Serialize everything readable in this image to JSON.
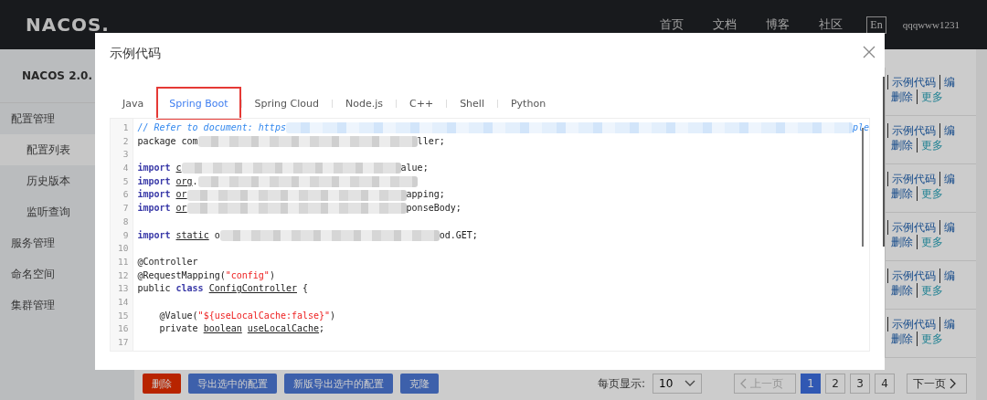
{
  "header": {
    "logo": "NACOS.",
    "nav": [
      "首页",
      "文档",
      "博客",
      "社区"
    ],
    "language": "En",
    "user": "qqqwww1231"
  },
  "sidebar": {
    "title": "NACOS 2.0.",
    "items": [
      {
        "label": "配置管理",
        "selected": false,
        "children": [
          {
            "label": "配置列表",
            "selected": true
          },
          {
            "label": "历史版本",
            "selected": false
          },
          {
            "label": "监听查询",
            "selected": false
          }
        ]
      },
      {
        "label": "服务管理",
        "selected": false
      },
      {
        "label": "命名空间",
        "selected": false
      },
      {
        "label": "集群管理",
        "selected": false
      }
    ]
  },
  "row_actions": [
    {
      "sample": "示例代码",
      "edit": "编",
      "delete": "删除",
      "more": "更多"
    },
    {
      "sample": "示例代码",
      "edit": "编",
      "delete": "删除",
      "more": "更多"
    },
    {
      "sample": "示例代码",
      "edit": "编",
      "delete": "删除",
      "more": "更多"
    },
    {
      "sample": "示例代码",
      "edit": "编",
      "delete": "删除",
      "more": "更多"
    },
    {
      "sample": "示例代码",
      "edit": "编",
      "delete": "删除",
      "more": "更多"
    },
    {
      "sample": "示例代码",
      "edit": "编",
      "delete": "删除",
      "more": "更多"
    }
  ],
  "bottom_buttons": [
    {
      "label": "删除",
      "kind": "danger"
    },
    {
      "label": "导出选中的配置",
      "kind": "primary"
    },
    {
      "label": "新版导出选中的配置",
      "kind": "primary"
    },
    {
      "label": "克隆",
      "kind": "primary"
    }
  ],
  "pagination": {
    "page_size_label": "每页显示:",
    "page_size": "10",
    "prev": "上一页",
    "prev_disabled": true,
    "pages": [
      {
        "label": "1",
        "selected": true
      },
      {
        "label": "2",
        "selected": false
      },
      {
        "label": "3",
        "selected": false
      },
      {
        "label": "4",
        "selected": false
      }
    ],
    "next": "下一页"
  },
  "dialog": {
    "title": "示例代码",
    "tabs": [
      {
        "label": "Java",
        "selected": false,
        "highlighted": false
      },
      {
        "label": "Spring Boot",
        "selected": true,
        "highlighted": true
      },
      {
        "label": "Spring Cloud",
        "selected": false,
        "highlighted": false
      },
      {
        "label": "Node.js",
        "selected": false,
        "highlighted": false
      },
      {
        "label": "C++",
        "selected": false,
        "highlighted": false
      },
      {
        "label": "Shell",
        "selected": false,
        "highlighted": false
      },
      {
        "label": "Python",
        "selected": false,
        "highlighted": false
      }
    ],
    "code_lines": [
      {
        "number": "1",
        "segments": [
          {
            "kind": "comment",
            "text": "// Refer to document: https"
          },
          {
            "kind": "redacted-comment"
          },
          {
            "kind": "comment",
            "text": "ple"
          }
        ]
      },
      {
        "number": "2",
        "segments": [
          {
            "kind": "plain",
            "text": "package com"
          },
          {
            "kind": "redacted"
          },
          {
            "kind": "plain",
            "text": "ller;"
          }
        ]
      },
      {
        "number": "3"
      },
      {
        "number": "4",
        "segments": [
          {
            "kind": "keyword",
            "text": "import "
          },
          {
            "kind": "ref",
            "text": "c"
          },
          {
            "kind": "redacted"
          },
          {
            "kind": "plain",
            "text": "alue;"
          }
        ]
      },
      {
        "number": "5",
        "segments": [
          {
            "kind": "keyword",
            "text": "import "
          },
          {
            "kind": "ref",
            "text": "org"
          },
          {
            "kind": "plain",
            "text": "."
          },
          {
            "kind": "redacted"
          }
        ]
      },
      {
        "number": "6",
        "segments": [
          {
            "kind": "keyword",
            "text": "import "
          },
          {
            "kind": "ref",
            "text": "or"
          },
          {
            "kind": "redacted"
          },
          {
            "kind": "plain",
            "text": "apping;"
          }
        ]
      },
      {
        "number": "7",
        "segments": [
          {
            "kind": "keyword",
            "text": "import "
          },
          {
            "kind": "ref",
            "text": "or"
          },
          {
            "kind": "redacted"
          },
          {
            "kind": "plain",
            "text": "ponseBody;"
          }
        ]
      },
      {
        "number": "8"
      },
      {
        "number": "9",
        "segments": [
          {
            "kind": "keyword",
            "text": "import "
          },
          {
            "kind": "ref",
            "text": "static"
          },
          {
            "kind": "plain",
            "text": " o"
          },
          {
            "kind": "redacted"
          },
          {
            "kind": "plain",
            "text": "od.GET;"
          }
        ]
      },
      {
        "number": "10"
      },
      {
        "number": "11",
        "segments": [
          {
            "kind": "plain",
            "text": "@Controller"
          }
        ]
      },
      {
        "number": "12",
        "segments": [
          {
            "kind": "plain",
            "text": "@RequestMapping("
          },
          {
            "kind": "string",
            "text": "\"config\""
          },
          {
            "kind": "plain",
            "text": ")"
          }
        ]
      },
      {
        "number": "13",
        "segments": [
          {
            "kind": "plain",
            "text": "public "
          },
          {
            "kind": "keyword",
            "text": "class "
          },
          {
            "kind": "ref",
            "text": "ConfigController"
          },
          {
            "kind": "plain",
            "text": " {"
          }
        ]
      },
      {
        "number": "14"
      },
      {
        "number": "15",
        "segments": [
          {
            "kind": "plain",
            "text": "    @Value("
          },
          {
            "kind": "string",
            "text": "\"${useLocalCache:false}\""
          },
          {
            "kind": "plain",
            "text": ")"
          }
        ]
      },
      {
        "number": "16",
        "segments": [
          {
            "kind": "plain",
            "text": "    private "
          },
          {
            "kind": "ref",
            "text": "boolean useLocalCache"
          },
          {
            "kind": "plain",
            "text": ";"
          }
        ]
      },
      {
        "number": "17"
      }
    ]
  }
}
